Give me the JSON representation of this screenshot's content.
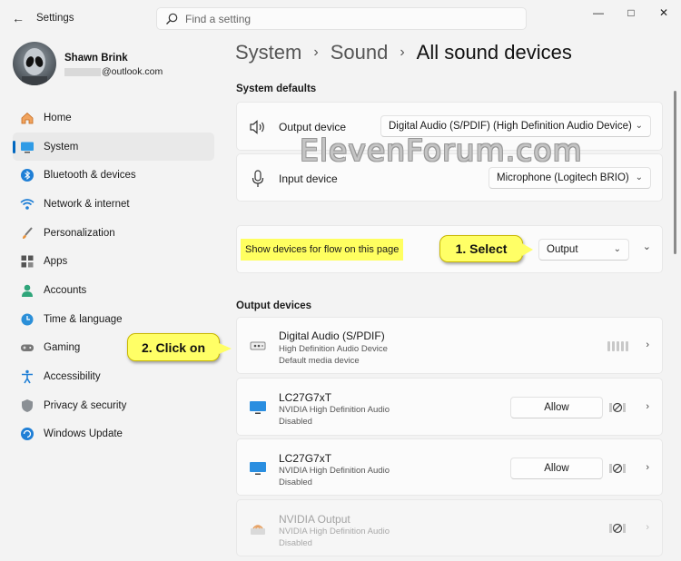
{
  "app": {
    "title": "Settings"
  },
  "search": {
    "placeholder": "Find a setting"
  },
  "user": {
    "name": "Shawn Brink",
    "email_domain": "@outlook.com"
  },
  "nav": {
    "items": [
      {
        "label": "Home",
        "icon": "home-icon"
      },
      {
        "label": "System",
        "icon": "display-icon",
        "active": true
      },
      {
        "label": "Bluetooth & devices",
        "icon": "bluetooth-icon"
      },
      {
        "label": "Network & internet",
        "icon": "wifi-icon"
      },
      {
        "label": "Personalization",
        "icon": "brush-icon"
      },
      {
        "label": "Apps",
        "icon": "apps-icon"
      },
      {
        "label": "Accounts",
        "icon": "person-icon"
      },
      {
        "label": "Time & language",
        "icon": "globe-clock-icon"
      },
      {
        "label": "Gaming",
        "icon": "gamepad-icon"
      },
      {
        "label": "Accessibility",
        "icon": "accessibility-icon"
      },
      {
        "label": "Privacy & security",
        "icon": "shield-icon"
      },
      {
        "label": "Windows Update",
        "icon": "update-icon"
      }
    ]
  },
  "breadcrumb": {
    "level1": "System",
    "level2": "Sound",
    "current": "All sound devices"
  },
  "system_defaults": {
    "title": "System defaults",
    "output_label": "Output device",
    "output_value": "Digital Audio (S/PDIF) (High Definition Audio Device)",
    "input_label": "Input device",
    "input_value": "Microphone (Logitech BRIO)"
  },
  "flow": {
    "label": "Show devices for flow on this page",
    "value": "Output"
  },
  "output_devices": {
    "title": "Output devices",
    "devices": [
      {
        "name": "Digital Audio (S/PDIF)",
        "driver": "High Definition Audio Device",
        "status": "Default media device"
      },
      {
        "name": "LC27G7xT",
        "driver": "NVIDIA High Definition Audio",
        "status": "Disabled",
        "button": "Allow"
      },
      {
        "name": "LC27G7xT",
        "driver": "NVIDIA High Definition Audio",
        "status": "Disabled",
        "button": "Allow"
      },
      {
        "name": "NVIDIA Output",
        "driver": "NVIDIA High Definition Audio",
        "status": "Disabled"
      }
    ]
  },
  "callouts": {
    "select": "1. Select",
    "click": "2. Click on"
  },
  "watermark": "ElevenForum.com",
  "colors": {
    "accent": "#0067c0",
    "callout": "#ffff66",
    "highlight": "#ffff60"
  }
}
